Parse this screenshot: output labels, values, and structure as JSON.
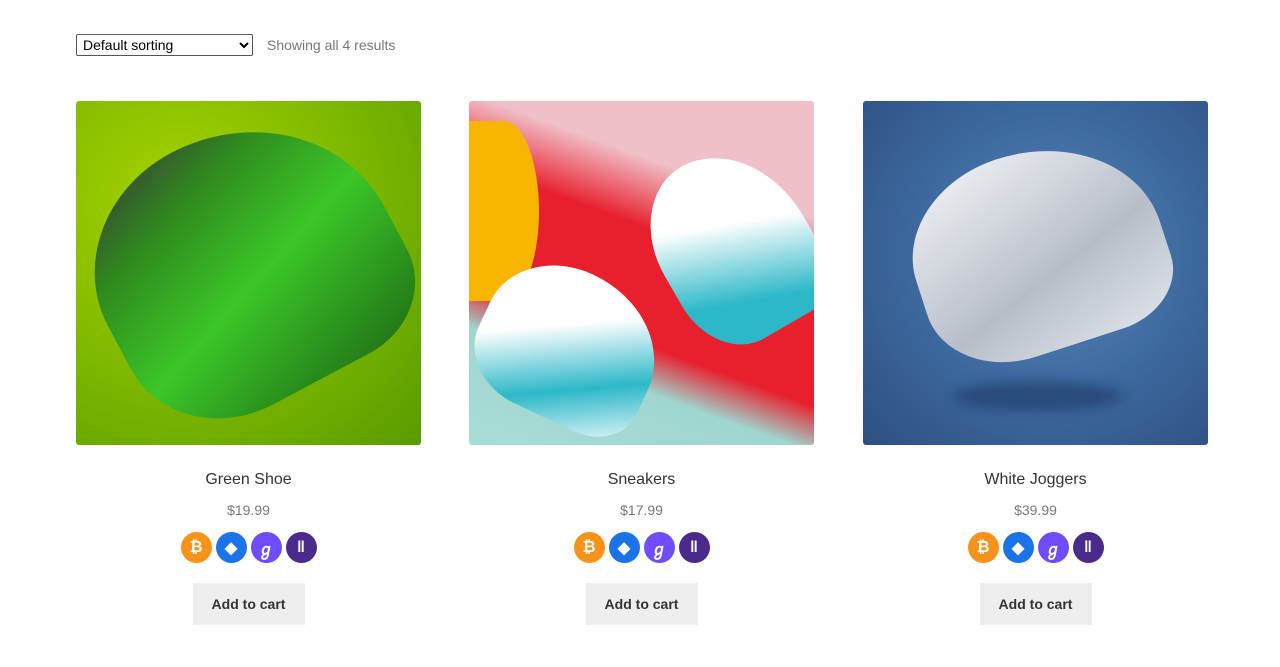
{
  "toolbar": {
    "sort_selected": "Default sorting",
    "result_count": "Showing all 4 results"
  },
  "products": [
    {
      "title": "Green Shoe",
      "price": "$19.99",
      "button": "Add to cart"
    },
    {
      "title": "Sneakers",
      "price": "$17.99",
      "button": "Add to cart"
    },
    {
      "title": "White Joggers",
      "price": "$39.99",
      "button": "Add to cart"
    }
  ],
  "payment_icons": [
    "bitcoin-icon",
    "ethereum-icon",
    "the-graph-icon",
    "token-icon"
  ],
  "colors": {
    "bitcoin": "#f7931a",
    "ethereum": "#1a73e8",
    "graph": "#6f4cff",
    "token": "#4a2a8a",
    "button_bg": "#eeeeee"
  }
}
